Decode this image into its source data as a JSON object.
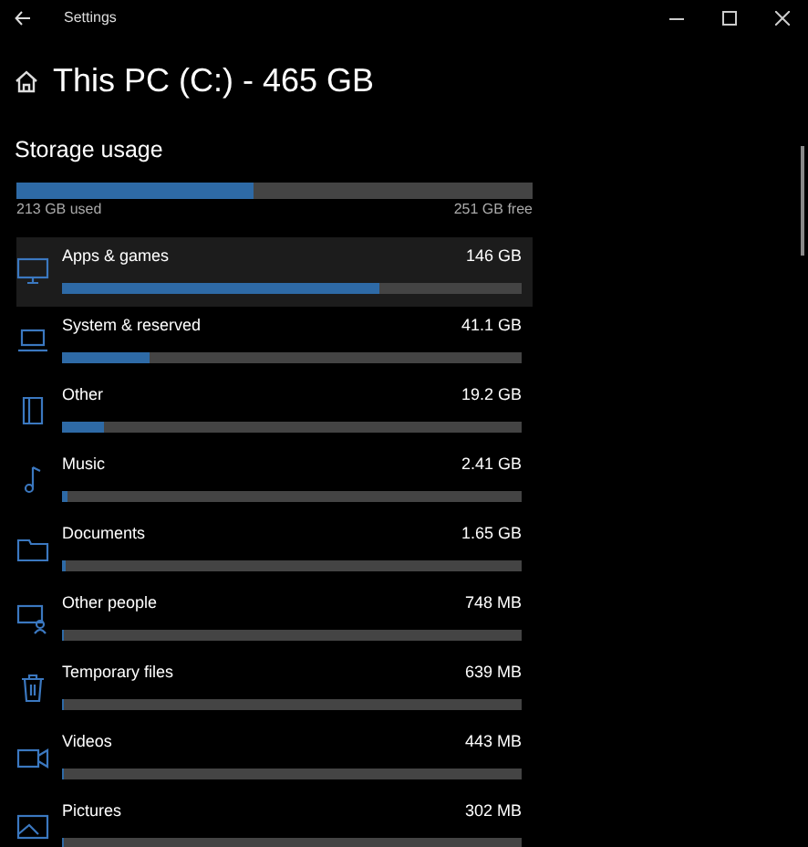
{
  "window": {
    "title": "Settings"
  },
  "page": {
    "title": "This PC (C:) - 465 GB"
  },
  "storage": {
    "heading": "Storage usage",
    "level": 0.46,
    "used": "213 GB used",
    "free": "251 GB free"
  },
  "categories": [
    {
      "name": "Apps & games",
      "size": "146 GB",
      "level": 0.69,
      "highlighted": true
    },
    {
      "name": "System & reserved",
      "size": "41.1 GB",
      "level": 0.19,
      "highlighted": false
    },
    {
      "name": "Other",
      "size": "19.2 GB",
      "level": 0.09,
      "highlighted": false
    },
    {
      "name": "Music",
      "size": "2.41 GB",
      "level": 0.01,
      "highlighted": false
    },
    {
      "name": "Documents",
      "size": "1.65 GB",
      "level": 0.008,
      "highlighted": false
    },
    {
      "name": "Other people",
      "size": "748 MB",
      "level": 0.005,
      "highlighted": false
    },
    {
      "name": "Temporary files",
      "size": "639 MB",
      "level": 0.005,
      "highlighted": false
    },
    {
      "name": "Videos",
      "size": "443 MB",
      "level": 0.004,
      "highlighted": false
    },
    {
      "name": "Pictures",
      "size": "302 MB",
      "level": 0.003,
      "highlighted": false
    }
  ]
}
